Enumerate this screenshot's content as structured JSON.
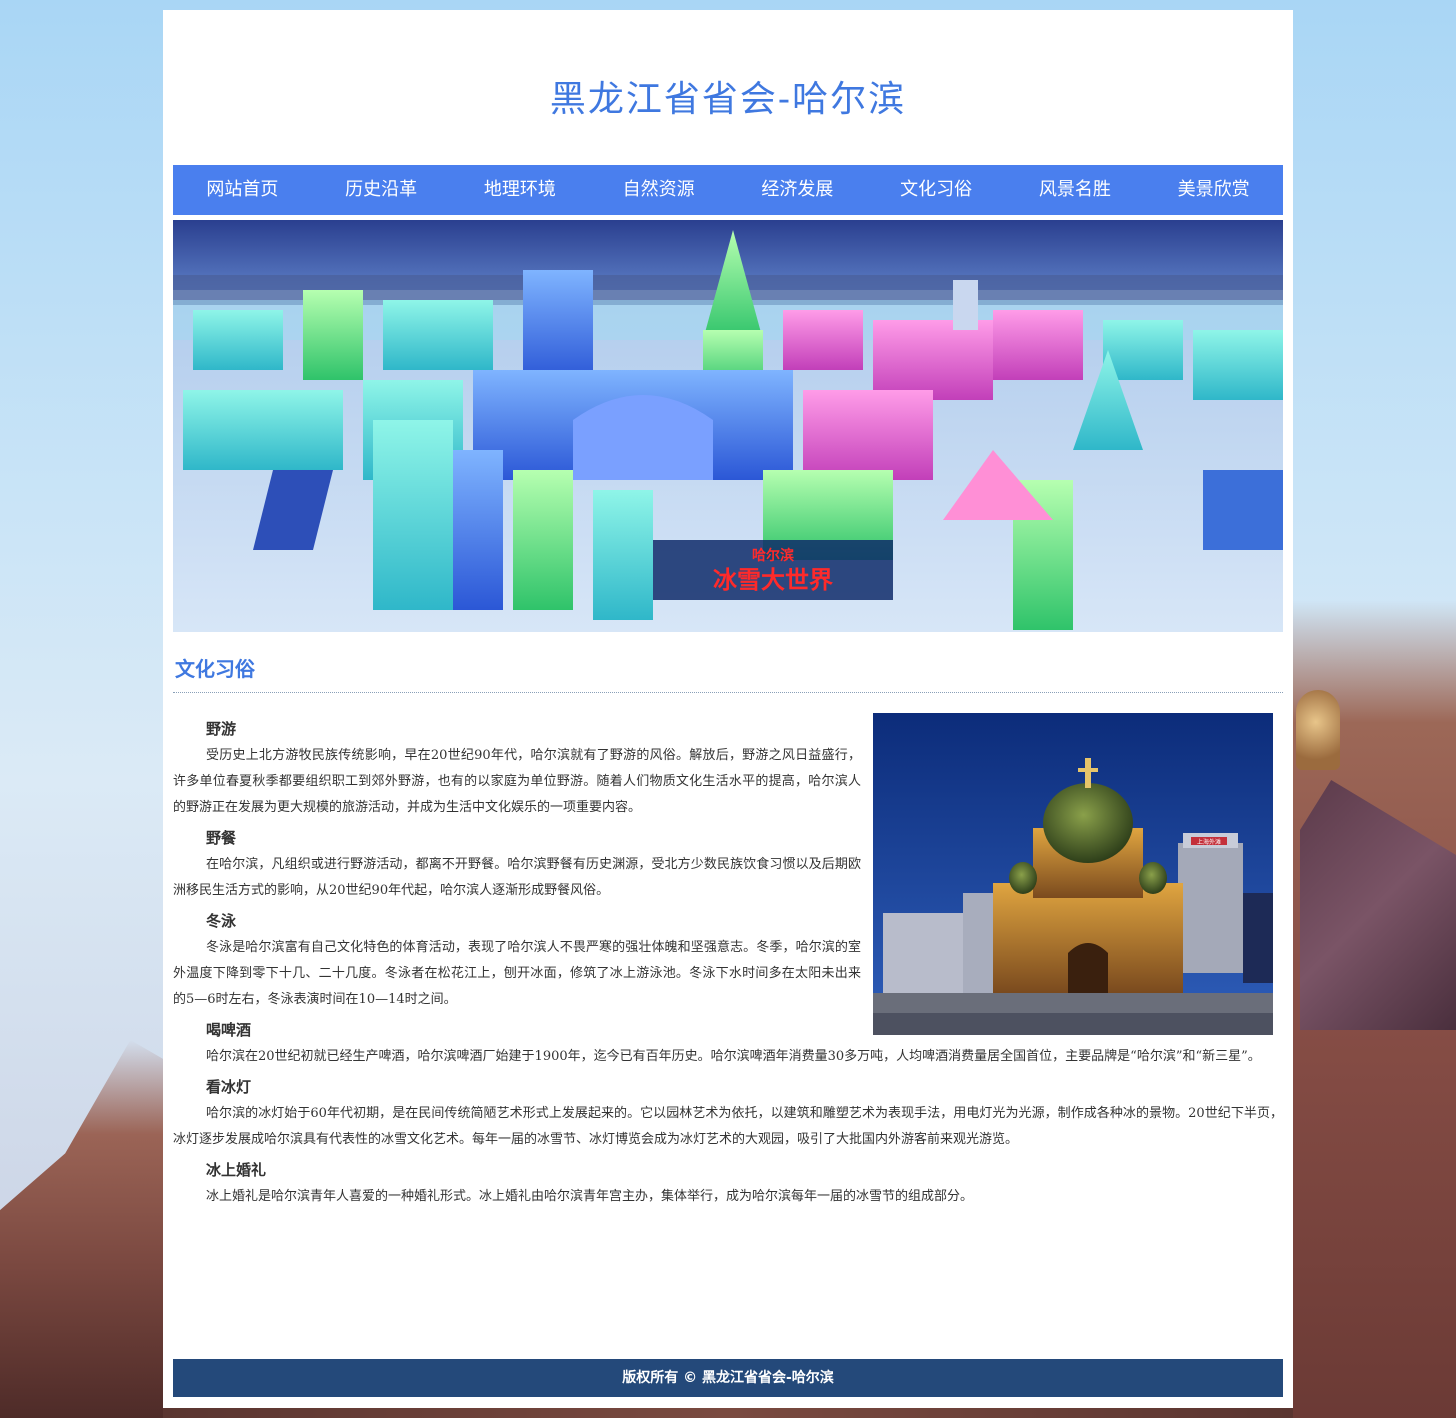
{
  "header": {
    "title": "黑龙江省省会-哈尔滨"
  },
  "nav": {
    "items": [
      "网站首页",
      "历史沿革",
      "地理环境",
      "自然资源",
      "经济发展",
      "文化习俗",
      "风景名胜",
      "美景欣赏"
    ]
  },
  "hero": {
    "sign_line1": "哈尔滨",
    "sign_line2": "冰雪大世界"
  },
  "section": {
    "title": "文化习俗"
  },
  "photo": {
    "sign": "上海外滩"
  },
  "articles": [
    {
      "heading": "野游",
      "body": "受历史上北方游牧民族传统影响，早在20世纪90年代，哈尔滨就有了野游的风俗。解放后，野游之风日益盛行，许多单位春夏秋季都要组织职工到郊外野游，也有的以家庭为单位野游。随着人们物质文化生活水平的提高，哈尔滨人的野游正在发展为更大规模的旅游活动，并成为生活中文化娱乐的一项重要内容。"
    },
    {
      "heading": "野餐",
      "body": "在哈尔滨，凡组织或进行野游活动，都离不开野餐。哈尔滨野餐有历史渊源，受北方少数民族饮食习惯以及后期欧洲移民生活方式的影响，从20世纪90年代起，哈尔滨人逐渐形成野餐风俗。"
    },
    {
      "heading": "冬泳",
      "body": "冬泳是哈尔滨富有自己文化特色的体育活动，表现了哈尔滨人不畏严寒的强壮体魄和坚强意志。冬季，哈尔滨的室外温度下降到零下十几、二十几度。冬泳者在松花江上，刨开冰面，修筑了冰上游泳池。冬泳下水时间多在太阳未出来的5—6时左右，冬泳表演时间在10—14时之间。"
    },
    {
      "heading": "喝啤酒",
      "body": "哈尔滨在20世纪初就已经生产啤酒，哈尔滨啤酒厂始建于1900年，迄今已有百年历史。哈尔滨啤酒年消费量30多万吨，人均啤酒消费量居全国首位，主要品牌是“哈尔滨”和“新三星”。"
    },
    {
      "heading": "看冰灯",
      "body": "哈尔滨的冰灯始于60年代初期，是在民间传统简陋艺术形式上发展起来的。它以园林艺术为依托，以建筑和雕塑艺术为表现手法，用电灯光为光源，制作成各种冰的景物。20世纪下半页，冰灯逐步发展成哈尔滨具有代表性的冰雪文化艺术。每年一届的冰雪节、冰灯博览会成为冰灯艺术的大观园，吸引了大批国内外游客前来观光游览。"
    },
    {
      "heading": "冰上婚礼",
      "body": "冰上婚礼是哈尔滨青年人喜爱的一种婚礼形式。冰上婚礼由哈尔滨青年宫主办，集体举行，成为哈尔滨每年一届的冰雪节的组成部分。"
    }
  ],
  "footer": {
    "text": "版权所有 © 黑龙江省省会-哈尔滨"
  }
}
